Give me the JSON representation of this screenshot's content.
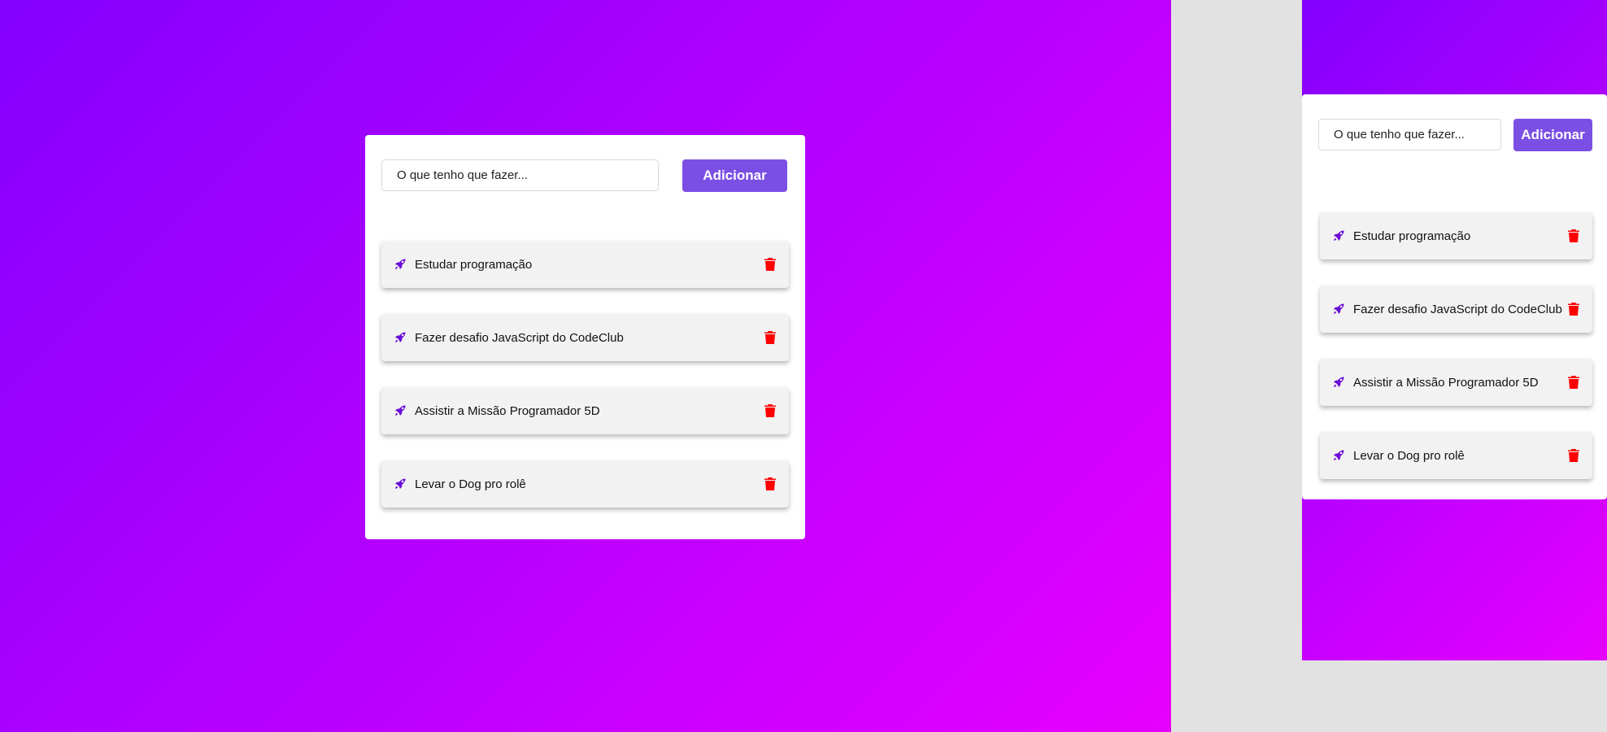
{
  "input": {
    "placeholder": "O que tenho que fazer..."
  },
  "add_button": {
    "label": "Adicionar"
  },
  "tasks": [
    {
      "text": "Estudar programação"
    },
    {
      "text": "Fazer desafio JavaScript do CodeClub"
    },
    {
      "text": "Assistir a Missão Programador 5D"
    },
    {
      "text": "Levar o Dog pro rolê"
    }
  ],
  "icons": {
    "task": "rocket-icon",
    "delete": "trash-icon"
  },
  "colors": {
    "gradient_start": "#8300ff",
    "gradient_end": "#e600ff",
    "button": "#7b4fe4",
    "delete_icon": "#ff0000",
    "rocket_icon": "#6a0dd9"
  }
}
